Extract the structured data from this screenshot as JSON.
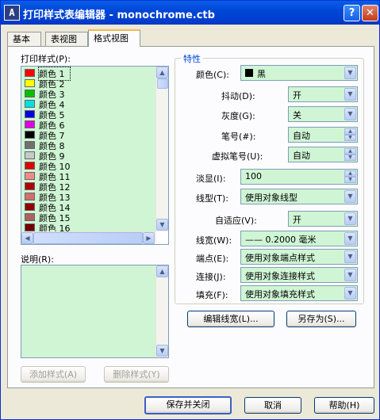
{
  "window": {
    "title": "打印样式表编辑器 - monochrome.ctb",
    "help_btn": "?",
    "close_btn": "✕",
    "app_icon": "A"
  },
  "tabs": [
    {
      "label": "基本"
    },
    {
      "label": "表视图"
    },
    {
      "label": "格式视图"
    }
  ],
  "left": {
    "styles_label": "打印样式",
    "styles_key": "(P):",
    "items": [
      {
        "label": "颜色  1",
        "color": "#ff0000"
      },
      {
        "label": "颜色  2",
        "color": "#ffff00"
      },
      {
        "label": "颜色  3",
        "color": "#00c000"
      },
      {
        "label": "颜色  4",
        "color": "#00e0e0"
      },
      {
        "label": "颜色  5",
        "color": "#0000e0"
      },
      {
        "label": "颜色  6",
        "color": "#e000e0"
      },
      {
        "label": "颜色  7",
        "color": "#000000"
      },
      {
        "label": "颜色  8",
        "color": "#707070"
      },
      {
        "label": "颜色  9",
        "color": "#c8c8c8"
      },
      {
        "label": "颜色  10",
        "color": "#e00000"
      },
      {
        "label": "颜色  11",
        "color": "#f08a8a"
      },
      {
        "label": "颜色  12",
        "color": "#b00000"
      },
      {
        "label": "颜色  13",
        "color": "#d07070"
      },
      {
        "label": "颜色  14",
        "color": "#900000"
      },
      {
        "label": "颜色  15",
        "color": "#b06060"
      },
      {
        "label": "颜色  16",
        "color": "#700000"
      }
    ],
    "desc_label": "说明",
    "desc_key": "(R):",
    "add_style": "添加样式(A)",
    "delete_style": "删除样式(Y)"
  },
  "props": {
    "group_title": "特性",
    "color": {
      "label": "颜色",
      "key": "(C):",
      "value": "黑"
    },
    "dither": {
      "label": "抖动",
      "key": "(D):",
      "value": "开"
    },
    "grayscale": {
      "label": "灰度",
      "key": "(G):",
      "value": "关"
    },
    "pen": {
      "label": "笔号",
      "key": "(#):",
      "value": "自动"
    },
    "virtual_pen": {
      "label": "虚拟笔号",
      "key": "(U):",
      "value": "自动"
    },
    "screening": {
      "label": "淡显",
      "key": "(I):",
      "value": "100"
    },
    "linetype": {
      "label": "线型",
      "key": "(T):",
      "value": "使用对象线型"
    },
    "adaptive": {
      "label": "自适应",
      "key": "(V):",
      "value": "开"
    },
    "lineweight": {
      "label": "线宽",
      "key": "(W):",
      "value": "—— 0.2000 毫米"
    },
    "endstyle": {
      "label": "端点",
      "key": "(E):",
      "value": "使用对象端点样式"
    },
    "joinstyle": {
      "label": "连接",
      "key": "(J):",
      "value": "使用对象连接样式"
    },
    "fillstyle": {
      "label": "填充",
      "key": "(F):",
      "value": "使用对象填充样式"
    },
    "edit_lineweights": "编辑线宽(L)...",
    "save_as": "另存为(S)..."
  },
  "footer": {
    "save_close": "保存并关闭",
    "cancel": "取消",
    "help": "帮助(H)"
  }
}
